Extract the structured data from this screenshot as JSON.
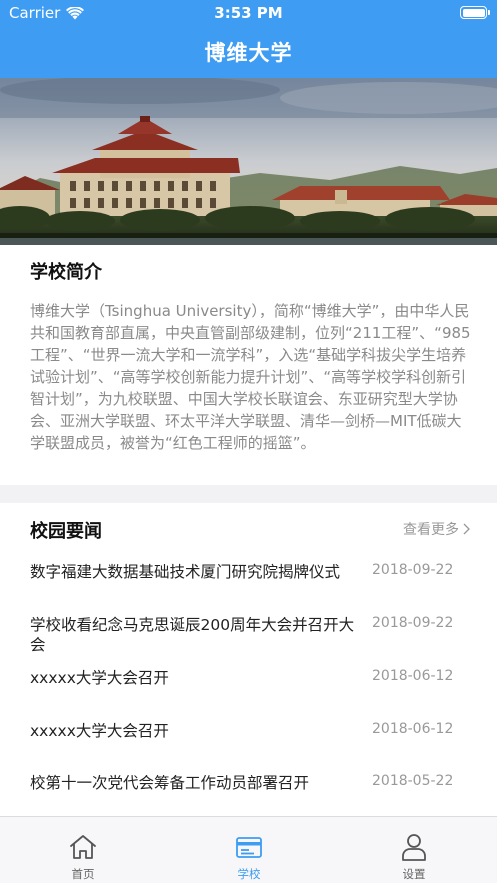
{
  "status_bar": {
    "carrier": "Carrier",
    "time": "3:53 PM"
  },
  "nav": {
    "title": "博维大学"
  },
  "intro": {
    "title": "学校简介",
    "text": "博维大学（Tsinghua University），简称“博维大学”，由中华人民共和国教育部直属，中央直管副部级建制，位列“211工程”、“985工程”、“世界一流大学和一流学科”，入选“基础学科拔尖学生培养试验计划”、“高等学校创新能力提升计划”、“高等学校学科创新引智计划”，为九校联盟、中国大学校长联谊会、东亚研究型大学协会、亚洲大学联盟、环太平洋大学联盟、清华—剑桥—MIT低碳大学联盟成员，被誉为“红色工程师的摇篮”。"
  },
  "news": {
    "title": "校园要闻",
    "more": "查看更多",
    "items": [
      {
        "title": "数字福建大数据基础技术厦门研究院揭牌仪式",
        "date": "2018-09-22"
      },
      {
        "title": "学校收看纪念马克思诞辰200周年大会并召开大会",
        "date": "2018-09-22"
      },
      {
        "title": "xxxxx大学大会召开",
        "date": "2018-06-12"
      },
      {
        "title": "xxxxx大学大会召开",
        "date": "2018-06-12"
      },
      {
        "title": "校第十一次党代会筹备工作动员部署召开",
        "date": "2018-05-22"
      }
    ]
  },
  "tabs": [
    {
      "label": "首页",
      "icon": "home-icon"
    },
    {
      "label": "学校",
      "icon": "school-card-icon"
    },
    {
      "label": "设置",
      "icon": "person-icon"
    }
  ],
  "colors": {
    "accent": "#3e9cf2",
    "text_gray": "#8a8a8a",
    "date_gray": "#999999"
  }
}
